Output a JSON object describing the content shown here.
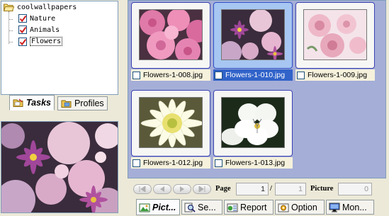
{
  "tree": {
    "root": "coolwallpapers",
    "items": [
      {
        "label": "Nature",
        "checked": true
      },
      {
        "label": "Animals",
        "checked": true
      },
      {
        "label": "Flowers",
        "checked": true,
        "selected": true
      }
    ]
  },
  "left_tabs": [
    {
      "label": "Tasks",
      "icon": "tasks-folder-icon",
      "active": true
    },
    {
      "label": "Profiles",
      "icon": "profiles-icon",
      "active": false
    }
  ],
  "thumbnails": [
    {
      "filename": "Flowers-1-008.jpg",
      "selected": false,
      "icon": "pink-dahlias-photo"
    },
    {
      "filename": "Flowers-1-010.jpg",
      "selected": true,
      "icon": "mixed-bouquet-photo"
    },
    {
      "filename": "Flowers-1-009.jpg",
      "selected": false,
      "icon": "pink-roses-photo"
    },
    {
      "filename": "Flowers-1-012.jpg",
      "selected": false,
      "icon": "white-chrysanthemum-photo"
    },
    {
      "filename": "Flowers-1-013.jpg",
      "selected": false,
      "icon": "white-pansy-photo"
    }
  ],
  "navigation": {
    "page_label": "Page",
    "page_value": "1",
    "page_separator": "/",
    "page_total": "1",
    "picture_label": "Picture",
    "picture_value": "0",
    "buttons": [
      "first-page-icon",
      "prev-page-icon",
      "next-page-icon",
      "last-page-icon"
    ]
  },
  "bottom_tabs": [
    {
      "label": "Pict...",
      "icon": "pictures-icon",
      "active": true
    },
    {
      "label": "Se...",
      "icon": "search-icon",
      "active": false
    },
    {
      "label": "Report",
      "icon": "report-icon",
      "active": false
    },
    {
      "label": "Option",
      "icon": "option-icon",
      "active": false
    },
    {
      "label": "Mon...",
      "icon": "monitor-icon",
      "active": false
    }
  ],
  "colors": {
    "gallery_bg": "#a5aed7",
    "selection_blue": "#3163c9",
    "checkmark_red": "#d02020"
  }
}
